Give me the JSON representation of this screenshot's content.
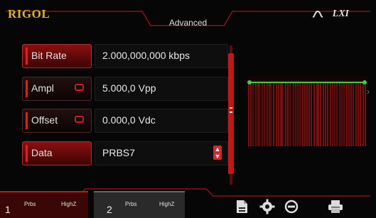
{
  "brand": {
    "logo": "RIGOL"
  },
  "header": {
    "title": "Advanced"
  },
  "status": {
    "icons": [
      "wave-icon",
      "lxi-icon"
    ],
    "lxi_text": "LXI"
  },
  "params": [
    {
      "label": "Bit Rate",
      "value": "2.000,000,000 kbps",
      "linked": false,
      "active": true
    },
    {
      "label": "Ampl",
      "value": "5.000,0 Vpp",
      "linked": true,
      "active": false
    },
    {
      "label": "Offset",
      "value": "0.000,0 Vdc",
      "linked": true,
      "active": false
    },
    {
      "label": "Data",
      "value": "PRBS7",
      "linked": false,
      "active": true,
      "has_spinner": true
    }
  ],
  "channels": [
    {
      "number": "1",
      "load": "Prbs",
      "impedance": "HighZ",
      "selected": true
    },
    {
      "number": "2",
      "load": "Prbs",
      "impedance": "HighZ",
      "selected": false
    }
  ],
  "toolbar": {
    "icons": [
      "file-icon",
      "gear-icon",
      "utility-icon",
      "printer-icon"
    ]
  },
  "colors": {
    "accent": "#c01818",
    "logo": "#e0b32a",
    "waveform": "#d02020",
    "marker": "#40d040"
  }
}
